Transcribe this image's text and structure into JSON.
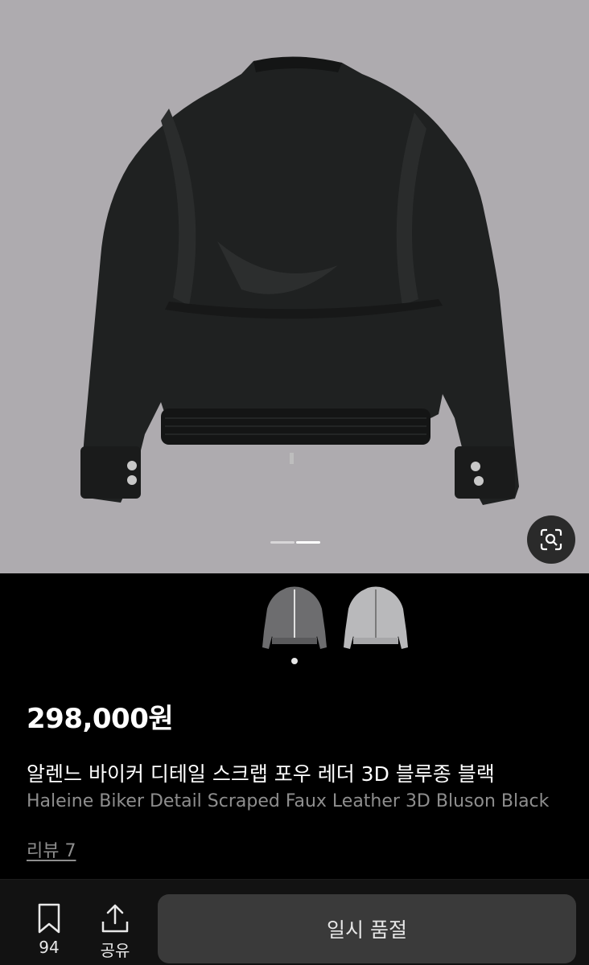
{
  "gallery": {
    "image_alt": "product-photo-black-jacket-back",
    "page_count": 2,
    "active_page": 2,
    "lens_icon": "lens-search-icon"
  },
  "thumbnails": [
    {
      "name": "gray-jacket-thumbnail",
      "selected": true
    },
    {
      "name": "light-gray-jacket-thumbnail",
      "selected": false
    }
  ],
  "product": {
    "price": "298,000원",
    "name_ko": "알렌느 바이커 디테일 스크랩 포우 레더 3D 블루종 블랙",
    "name_en": "Haleine Biker Detail Scraped Faux Leather 3D Bluson Black",
    "review_link": "리뷰 7"
  },
  "bottom_bar": {
    "bookmark_count": "94",
    "share_label": "공유",
    "action_label": "일시 품절"
  },
  "colors": {
    "hero_bg": "#aeabaf",
    "page_bg": "#000000",
    "button_bg": "#3a3a3a"
  }
}
